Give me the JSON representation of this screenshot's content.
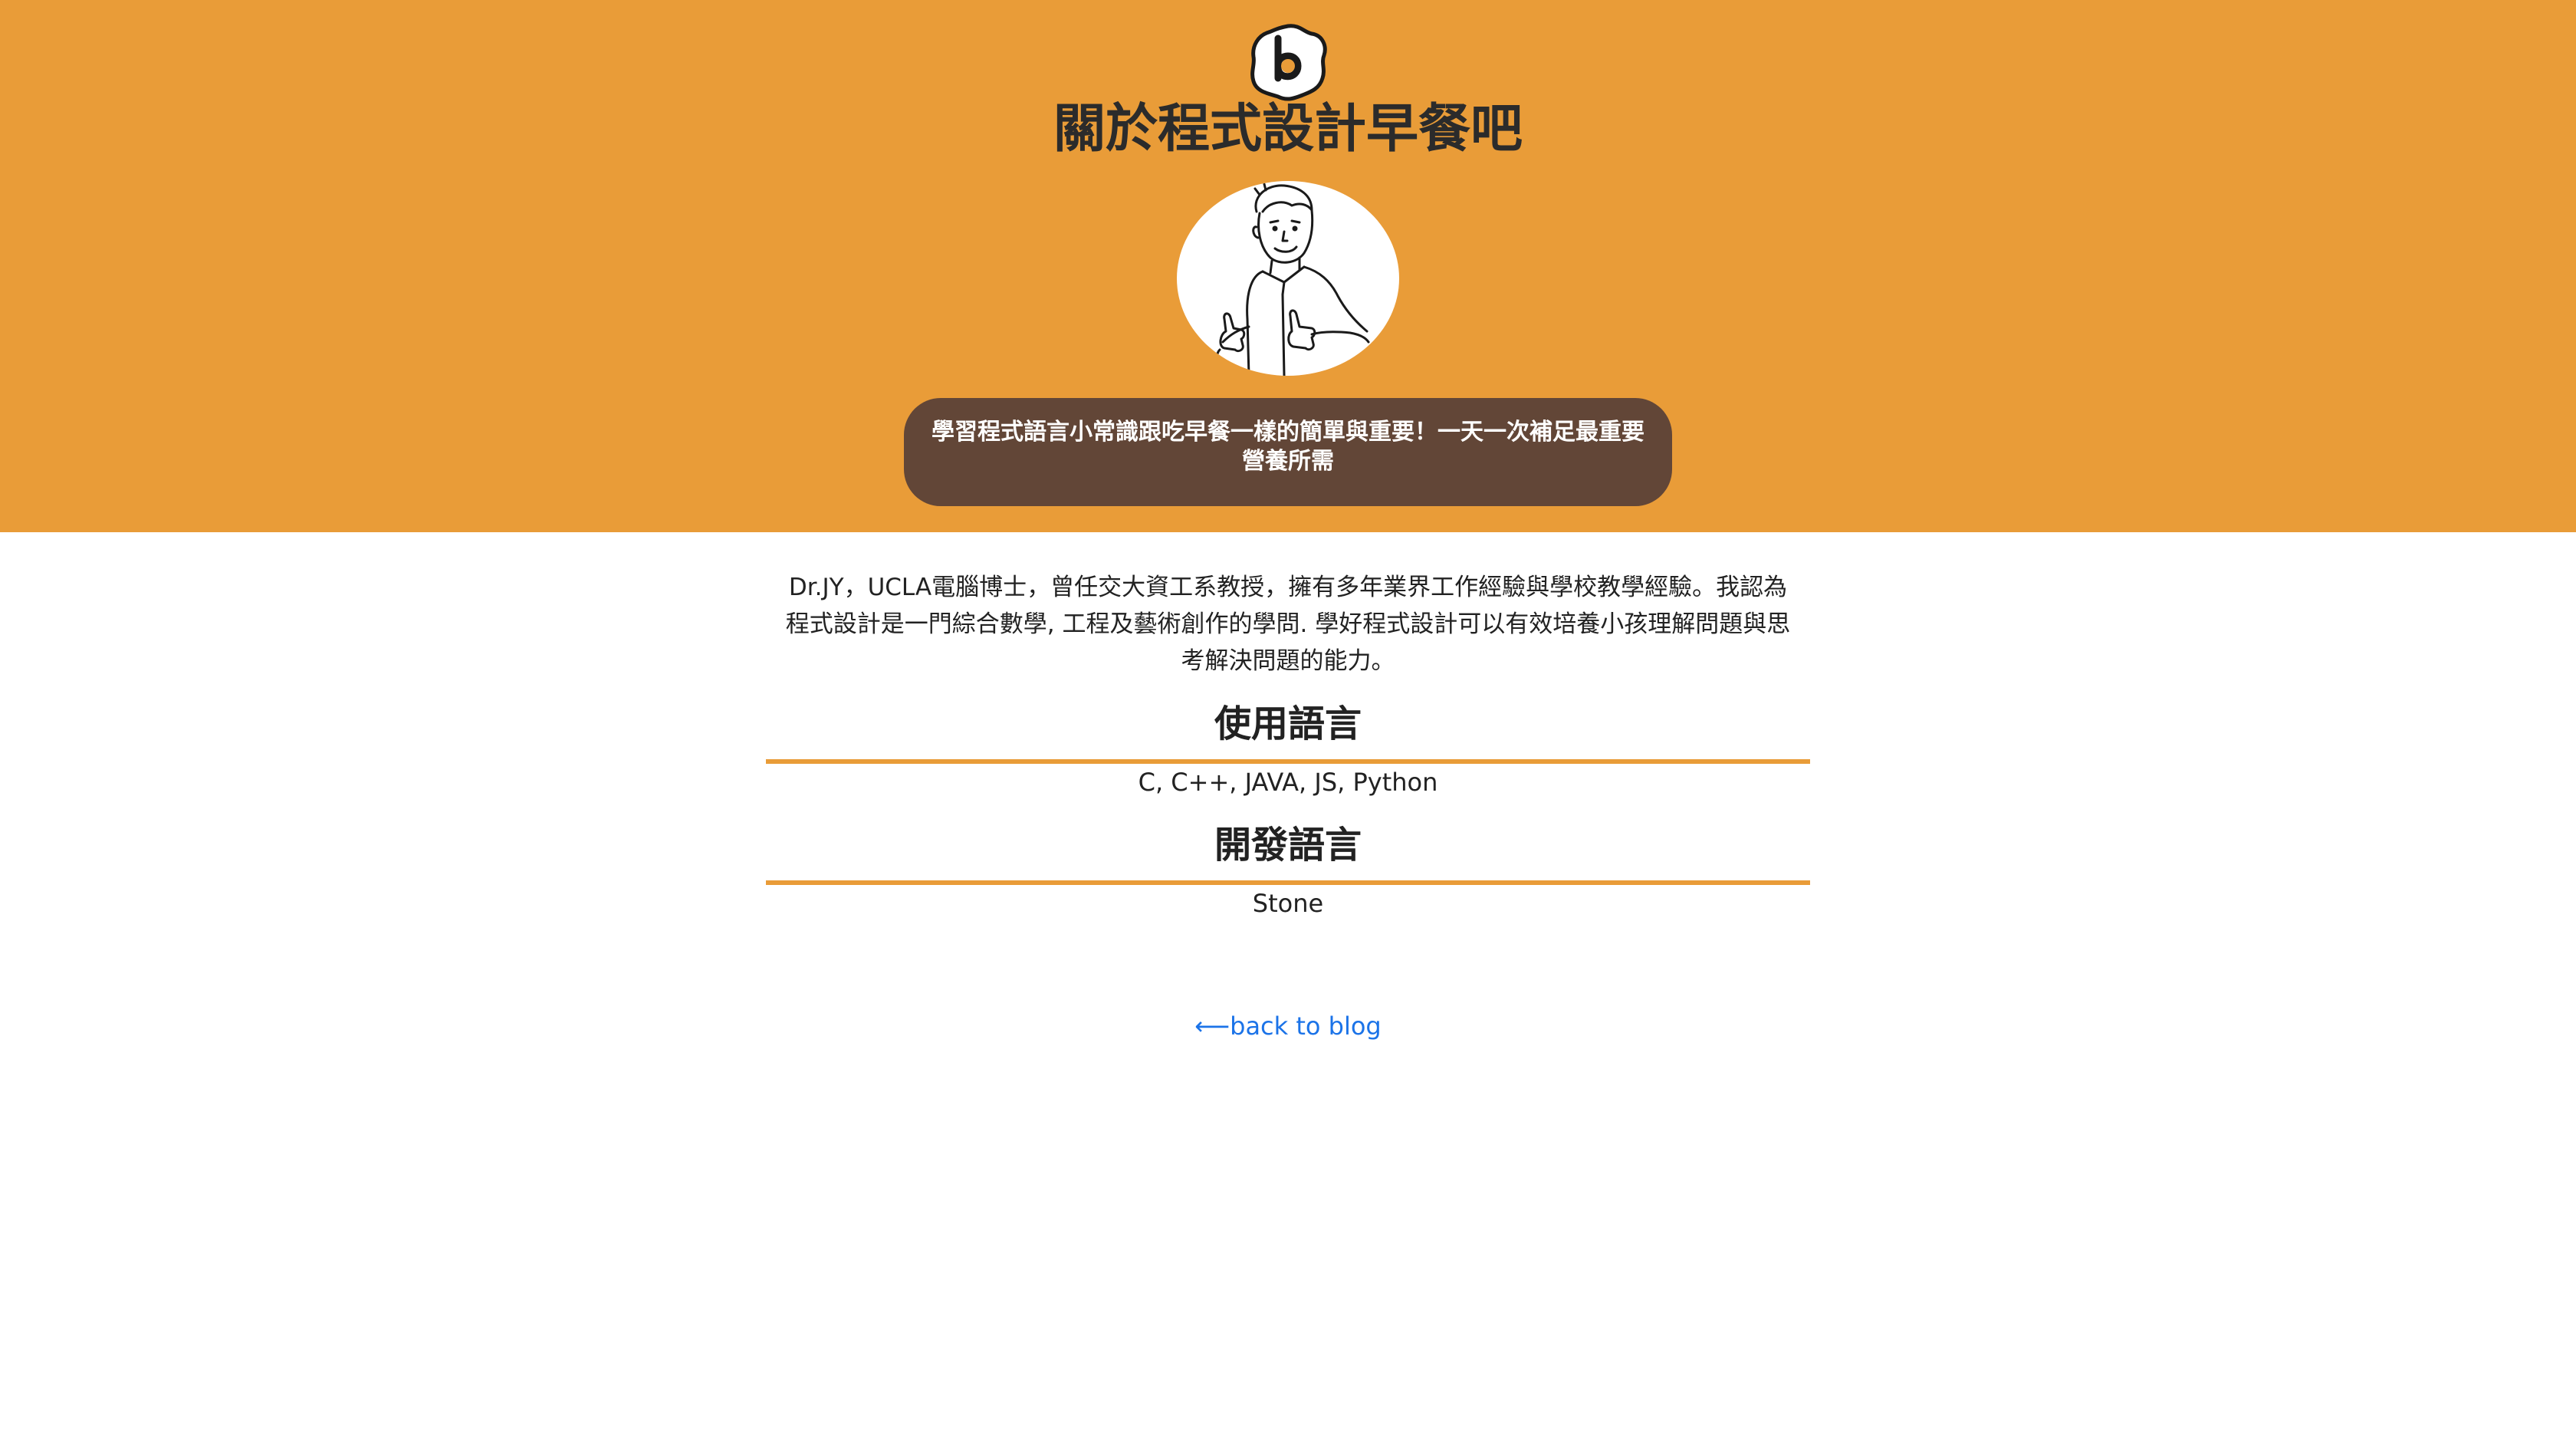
{
  "page": {
    "title": "關於程式設計早餐吧",
    "tagline": "學習程式語言小常識跟吃早餐一樣的簡單與重要！一天一次補足最重要營養所需",
    "intro": "Dr.JY，UCLA電腦博士，曾任交大資工系教授，擁有多年業界工作經驗與學校教學經驗。我認為程式設計是一門綜合數學, 工程及藝術創作的學問. 學好程式設計可以有效培養小孩理解問題與思考解決問題的能力。"
  },
  "sections": [
    {
      "title": "使用語言",
      "body": "C, C++, JAVA, JS, Python"
    },
    {
      "title": "開發語言",
      "body": "Stone"
    }
  ],
  "back_link": {
    "arrow": "⟵",
    "label": "back to blog"
  },
  "icons": {
    "logo": "fried-egg-b-logo-icon",
    "avatar": "man-thumbs-up-illustration"
  },
  "colors": {
    "hero": "#e99c38",
    "tagline_bg": "#624637",
    "accent_rule": "#e99c38",
    "link": "#1b73e8"
  }
}
